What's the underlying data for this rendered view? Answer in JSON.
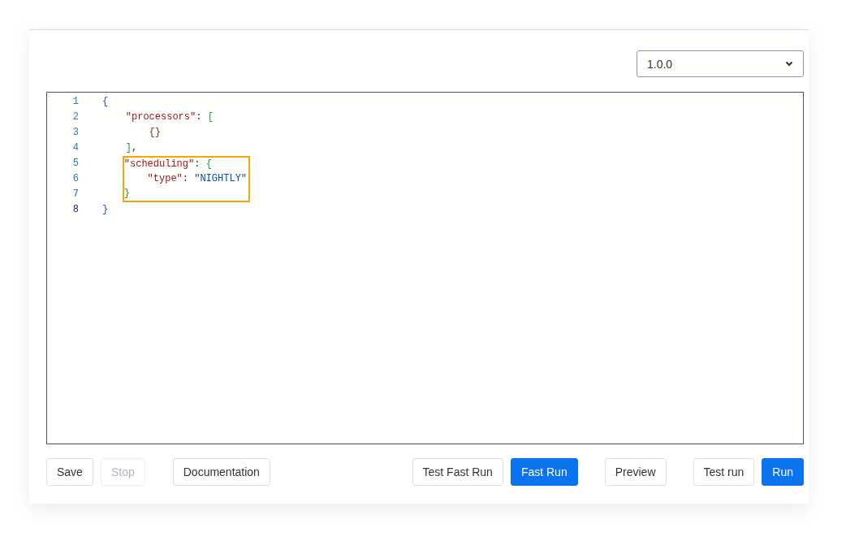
{
  "version_select": {
    "value": "1.0.0"
  },
  "editor": {
    "lines": [
      {
        "number": "1",
        "highlighted": false,
        "tokens": [
          {
            "kind": "brace",
            "text": "{"
          }
        ]
      },
      {
        "number": "2",
        "highlighted": false,
        "tokens": [
          {
            "kind": "key",
            "text": "\"processors\""
          },
          {
            "kind": "punct",
            "text": ": "
          },
          {
            "kind": "bracket",
            "text": "["
          }
        ]
      },
      {
        "number": "3",
        "highlighted": false,
        "tokens": [
          {
            "kind": "inner",
            "text": "{}"
          }
        ]
      },
      {
        "number": "4",
        "highlighted": false,
        "tokens": [
          {
            "kind": "bracket",
            "text": "]"
          },
          {
            "kind": "punct",
            "text": ","
          }
        ]
      },
      {
        "number": "5",
        "highlighted": true,
        "tokens": [
          {
            "kind": "key",
            "text": "\"scheduling\""
          },
          {
            "kind": "punct",
            "text": ": "
          },
          {
            "kind": "bracket",
            "text": "{"
          }
        ]
      },
      {
        "number": "6",
        "highlighted": true,
        "tokens": [
          {
            "kind": "key",
            "text": "\"type\""
          },
          {
            "kind": "punct",
            "text": ": "
          },
          {
            "kind": "string",
            "text": "\"NIGHTLY\""
          }
        ]
      },
      {
        "number": "7",
        "highlighted": true,
        "tokens": [
          {
            "kind": "bracket",
            "text": "}"
          }
        ]
      },
      {
        "number": "8",
        "highlighted": false,
        "tokens": [
          {
            "kind": "brace",
            "text": "}"
          }
        ]
      }
    ]
  },
  "toolbar": {
    "left": [
      [
        {
          "label": "Save",
          "kind": "default",
          "disabled": false
        },
        {
          "label": "Stop",
          "kind": "default",
          "disabled": true
        }
      ],
      [
        {
          "label": "Documentation",
          "kind": "default",
          "disabled": false
        }
      ]
    ],
    "right": [
      [
        {
          "label": "Test Fast Run",
          "kind": "default",
          "disabled": false
        },
        {
          "label": "Fast Run",
          "kind": "primary",
          "disabled": false
        }
      ],
      [
        {
          "label": "Preview",
          "kind": "default",
          "disabled": false
        }
      ],
      [
        {
          "label": "Test run",
          "kind": "default",
          "disabled": false
        },
        {
          "label": "Run",
          "kind": "primary",
          "disabled": false
        }
      ]
    ]
  }
}
